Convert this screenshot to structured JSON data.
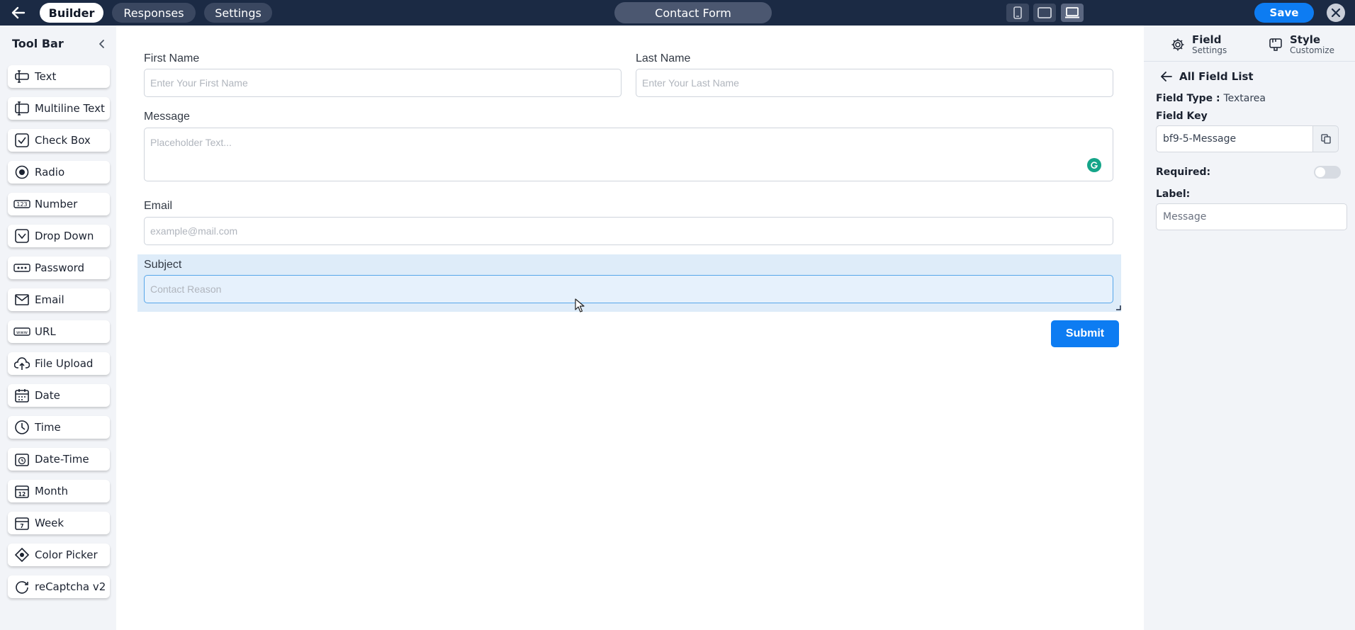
{
  "topbar": {
    "tabs": [
      {
        "label": "Builder",
        "active": true
      },
      {
        "label": "Responses",
        "active": false
      },
      {
        "label": "Settings",
        "active": false
      }
    ],
    "form_title": "Contact Form",
    "devices": [
      "mobile-icon",
      "tablet-icon",
      "laptop-icon"
    ],
    "active_device": "laptop-icon",
    "save_label": "Save"
  },
  "toolbar": {
    "title": "Tool Bar",
    "items": [
      {
        "label": "Text",
        "icon": "text-field-icon"
      },
      {
        "label": "Multiline Text",
        "icon": "multiline-text-icon"
      },
      {
        "label": "Check Box",
        "icon": "checkbox-icon"
      },
      {
        "label": "Radio",
        "icon": "radio-icon"
      },
      {
        "label": "Number",
        "icon": "number-icon"
      },
      {
        "label": "Drop Down",
        "icon": "dropdown-icon"
      },
      {
        "label": "Password",
        "icon": "password-icon"
      },
      {
        "label": "Email",
        "icon": "email-icon"
      },
      {
        "label": "URL",
        "icon": "url-icon"
      },
      {
        "label": "File Upload",
        "icon": "upload-icon"
      },
      {
        "label": "Date",
        "icon": "calendar-icon"
      },
      {
        "label": "Time",
        "icon": "clock-icon"
      },
      {
        "label": "Date-Time",
        "icon": "date-time-icon"
      },
      {
        "label": "Month",
        "icon": "month-icon"
      },
      {
        "label": "Week",
        "icon": "week-icon"
      },
      {
        "label": "Color Picker",
        "icon": "color-picker-icon"
      },
      {
        "label": "reCaptcha v2",
        "icon": "recaptcha-icon"
      }
    ]
  },
  "form": {
    "first_name": {
      "label": "First Name",
      "placeholder": "Enter Your First Name"
    },
    "last_name": {
      "label": "Last Name",
      "placeholder": "Enter Your Last Name"
    },
    "message": {
      "label": "Message",
      "placeholder": "Placeholder Text..."
    },
    "email": {
      "label": "Email",
      "placeholder": "example@mail.com"
    },
    "subject": {
      "label": "Subject",
      "placeholder": "Contact Reason",
      "selected": true
    },
    "submit_label": "Submit"
  },
  "panel": {
    "tabs": [
      {
        "main": "Field",
        "sub": "Settings",
        "icon": "gear-icon"
      },
      {
        "main": "Style",
        "sub": "Customize",
        "icon": "palette-icon"
      }
    ],
    "all_fields_label": "All Field List",
    "field_type_label": "Field Type :",
    "field_type_value": "Textarea",
    "field_key_label": "Field Key",
    "field_key_value": "bf9-5-Message",
    "required_label": "Required:",
    "required_on": false,
    "label_label": "Label:",
    "label_value": "Message"
  },
  "colors": {
    "topbar": "#1b2a44",
    "accent": "#0d7cf2",
    "selected_bg": "#deecf9"
  }
}
